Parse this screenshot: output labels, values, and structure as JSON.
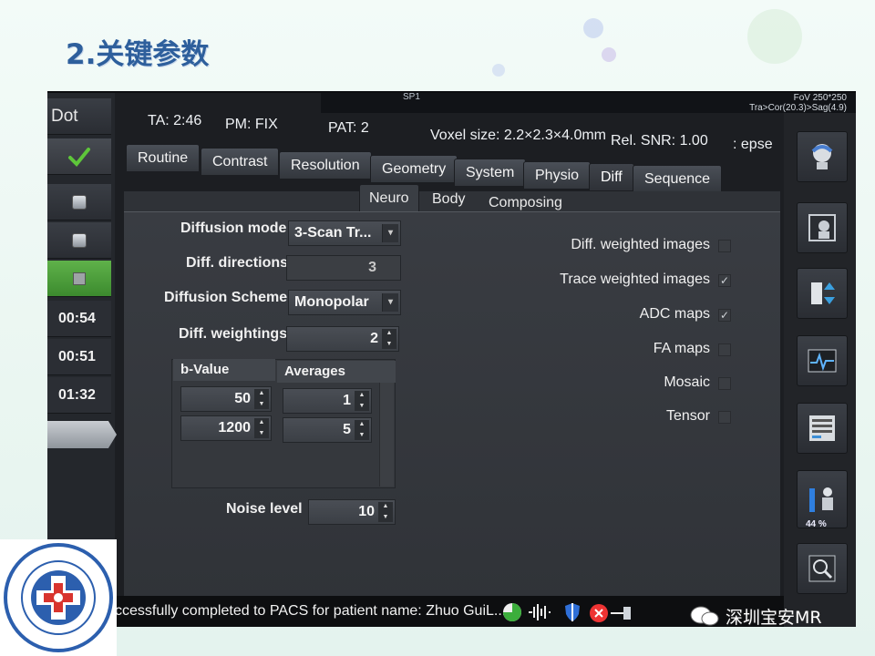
{
  "slide": {
    "title": "2.关键参数"
  },
  "top": {
    "scout": "SP1",
    "fov_line1": "FoV 250*250",
    "fov_line2": "Tra>Cor(20.3)>Sag(4.9)"
  },
  "left": {
    "dot": "Dot",
    "times": [
      "00:54",
      "00:51",
      "01:32"
    ]
  },
  "header": {
    "ta": "TA: 2:46",
    "pm": "PM: FIX",
    "pat": "PAT: 2",
    "voxel": "Voxel size: 2.2×2.3×4.0mm",
    "snr": "Rel. SNR: 1.00",
    "seq": ": epse"
  },
  "tabs": [
    "Routine",
    "Contrast",
    "Resolution",
    "Geometry",
    "System",
    "Physio",
    "Diff",
    "Sequence"
  ],
  "active_tab": "Diff",
  "subtabs": [
    "Neuro",
    "Body",
    "Composing"
  ],
  "active_subtab": "Neuro",
  "params": {
    "diffusion_mode": {
      "label": "Diffusion mode",
      "value": "3-Scan Tr..."
    },
    "diff_directions": {
      "label": "Diff. directions",
      "value": "3"
    },
    "diffusion_scheme": {
      "label": "Diffusion Scheme",
      "value": "Monopolar"
    },
    "diff_weightings": {
      "label": "Diff. weightings",
      "value": "2"
    },
    "noise_level": {
      "label": "Noise level",
      "value": "10"
    }
  },
  "bvalue_table": {
    "headers": [
      "b-Value",
      "Averages"
    ],
    "rows": [
      {
        "b": "50",
        "avg": "1"
      },
      {
        "b": "1200",
        "avg": "5"
      }
    ]
  },
  "options": [
    {
      "label": "Diff. weighted images",
      "checked": false
    },
    {
      "label": "Trace weighted images",
      "checked": true
    },
    {
      "label": "ADC maps",
      "checked": true
    },
    {
      "label": "FA maps",
      "checked": false
    },
    {
      "label": "Mosaic",
      "checked": false
    },
    {
      "label": "Tensor",
      "checked": false
    }
  ],
  "right_panel": {
    "percent": "44 %"
  },
  "status": {
    "message": "ccessfully completed to PACS for patient name: Zhuo GuiL..."
  },
  "watermark": {
    "text": "深圳宝安MR"
  },
  "colors": {
    "check_green": "#5ec63a",
    "title_blue": "#2e5f9c"
  }
}
